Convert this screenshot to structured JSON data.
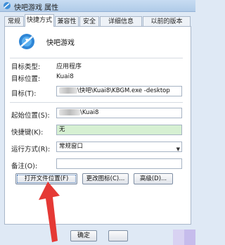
{
  "window": {
    "title": "快吧游戏 属性"
  },
  "tabs": [
    {
      "label": "常规",
      "active": false
    },
    {
      "label": "快捷方式",
      "active": true
    },
    {
      "label": "兼容性",
      "active": false
    },
    {
      "label": "安全",
      "active": false
    },
    {
      "label": "详细信息",
      "active": false
    },
    {
      "label": "以前的版本",
      "active": false
    }
  ],
  "shortcut": {
    "name": "快吧游戏",
    "target_type_label": "目标类型:",
    "target_type_value": "应用程序",
    "target_location_label": "目标位置:",
    "target_location_value": "Kuai8",
    "target_label": "目标(T):",
    "target_value_prefix": "\\快吧",
    "target_value_rest": "\\Kuai8\\KBGM.exe -desktop",
    "start_in_label": "起始位置(S):",
    "start_in_value": "\\Kuai8",
    "hotkey_label": "快捷键(K):",
    "hotkey_value": "无",
    "run_label": "运行方式(R):",
    "run_value": "常规窗口",
    "comment_label": "备注(O):",
    "comment_value": ""
  },
  "buttons": {
    "open_location": "打开文件位置(F)",
    "change_icon": "更改图标(C)...",
    "advanced": "高级(D)...",
    "ok": "确定"
  },
  "colors": {
    "hotkey_field_bg": "#d6f0d2",
    "annotation_arrow": "#e53935"
  }
}
